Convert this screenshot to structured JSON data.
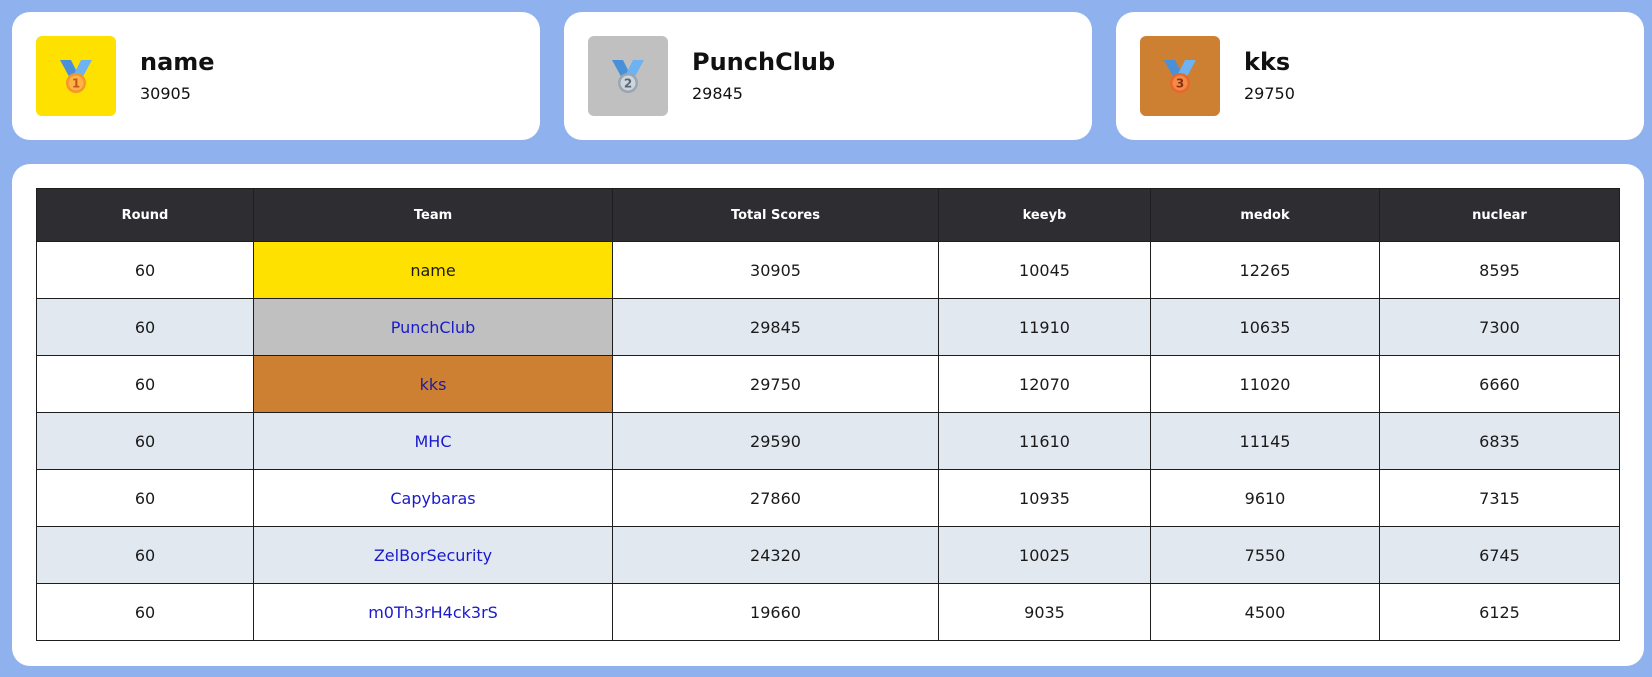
{
  "podium": [
    {
      "rank": "1",
      "name": "name",
      "score": "30905",
      "color": "#ffe100"
    },
    {
      "rank": "2",
      "name": "PunchClub",
      "score": "29845",
      "color": "#c0c0c0"
    },
    {
      "rank": "3",
      "name": "kks",
      "score": "29750",
      "color": "#cd7f32"
    }
  ],
  "table": {
    "headers": [
      "Round",
      "Team",
      "Total Scores",
      "keeyb",
      "medok",
      "nuclear"
    ],
    "rows": [
      {
        "round": "60",
        "team": "name",
        "total": "30905",
        "keeyb": "10045",
        "medok": "12265",
        "nuclear": "8595",
        "highlight": "#ffe100"
      },
      {
        "round": "60",
        "team": "PunchClub",
        "total": "29845",
        "keeyb": "11910",
        "medok": "10635",
        "nuclear": "7300",
        "highlight": "#c0c0c0"
      },
      {
        "round": "60",
        "team": "kks",
        "total": "29750",
        "keeyb": "12070",
        "medok": "11020",
        "nuclear": "6660",
        "highlight": "#cd7f32"
      },
      {
        "round": "60",
        "team": "MHC",
        "total": "29590",
        "keeyb": "11610",
        "medok": "11145",
        "nuclear": "6835"
      },
      {
        "round": "60",
        "team": "Capybaras",
        "total": "27860",
        "keeyb": "10935",
        "medok": "9610",
        "nuclear": "7315"
      },
      {
        "round": "60",
        "team": "ZelBorSecurity",
        "total": "24320",
        "keeyb": "10025",
        "medok": "7550",
        "nuclear": "6745"
      },
      {
        "round": "60",
        "team": "m0Th3rH4ck3rS",
        "total": "19660",
        "keeyb": "9035",
        "medok": "4500",
        "nuclear": "6125"
      }
    ]
  },
  "colors": {
    "background": "#8fb2ef",
    "header_bg": "#2e2d32",
    "alt_row": "#e2e8f0",
    "team_link": "#1a1acd"
  },
  "icons": {
    "medal": "medal-icon"
  }
}
